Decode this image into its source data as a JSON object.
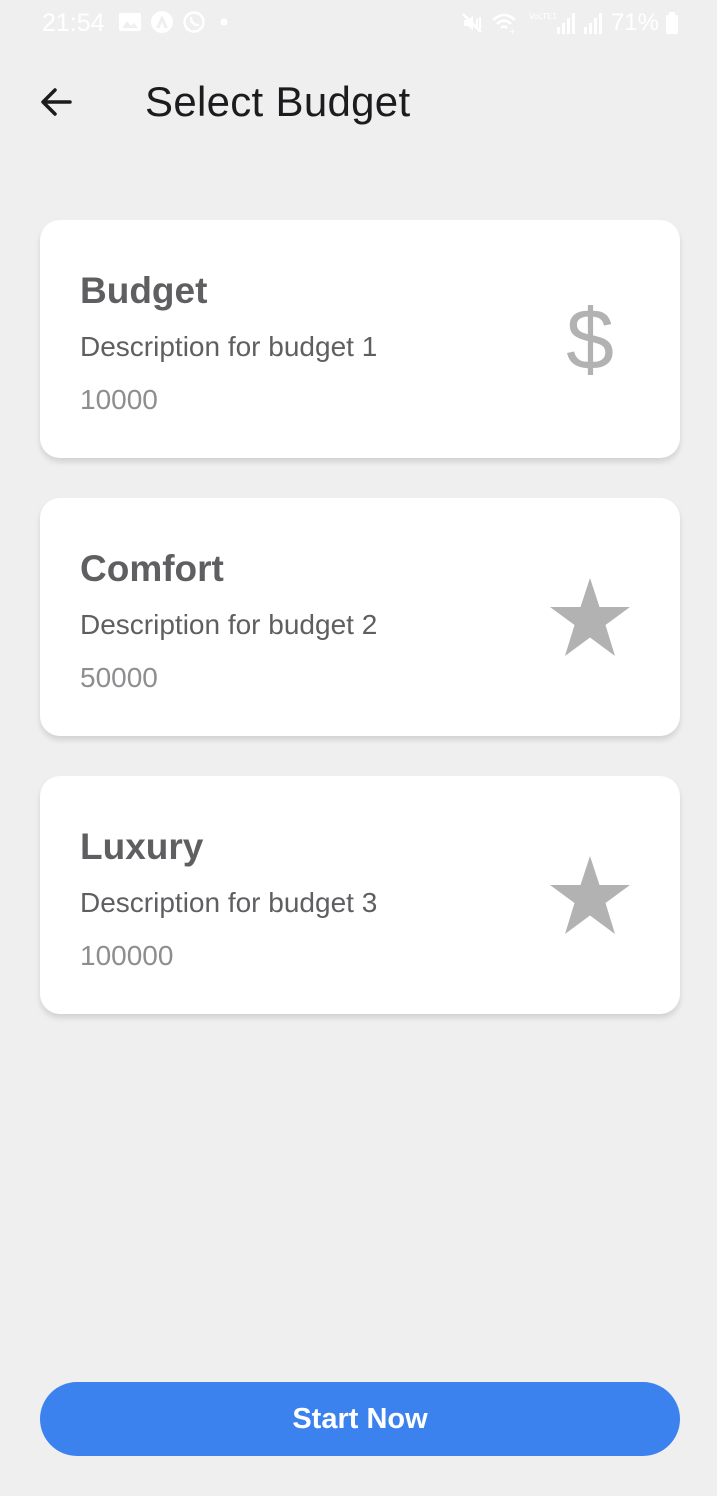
{
  "status_bar": {
    "time": "21:54",
    "battery": "71%",
    "network_label": "VoLTE1",
    "icons": [
      "gallery-icon",
      "app-icon",
      "whatsapp-icon",
      "dot-icon",
      "mute-icon",
      "wifi-icon",
      "signal-icon",
      "signal-icon",
      "battery-icon"
    ]
  },
  "header": {
    "title": "Select Budget",
    "back_icon": "arrow-left-icon"
  },
  "budgets": [
    {
      "title": "Budget",
      "description": "Description for budget 1",
      "amount": "10000",
      "icon": "dollar-icon",
      "icon_glyph": "$"
    },
    {
      "title": "Comfort",
      "description": "Description for budget 2",
      "amount": "50000",
      "icon": "star-icon"
    },
    {
      "title": "Luxury",
      "description": "Description for budget 3",
      "amount": "100000",
      "icon": "star-icon"
    }
  ],
  "footer": {
    "start_label": "Start Now"
  },
  "colors": {
    "background": "#efeff0",
    "accent": "#3b82ef",
    "icon": "#b2b2b2",
    "title_text": "#1c1c1e",
    "card_text": "#5f5f62",
    "muted_text": "#8e8e91"
  }
}
